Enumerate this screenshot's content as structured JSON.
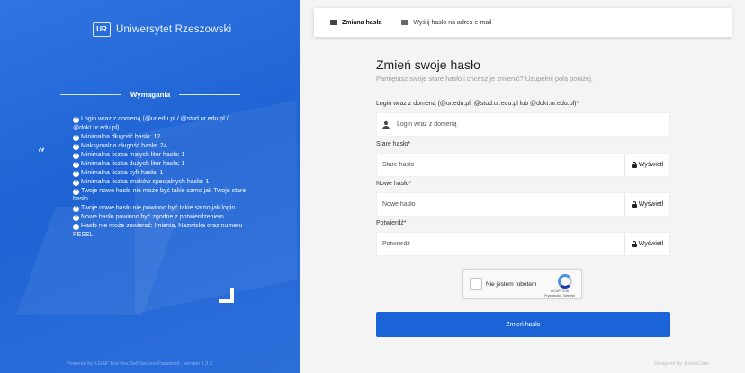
{
  "brand": {
    "logo_mark": "UR",
    "name": "Uniwersytet Rzeszowski"
  },
  "requirements": {
    "title": "Wymagania",
    "items": [
      "Login wraz z domeną (@ur.edu.pl / @stud.ur.edu.pl / @dokt.ur.edu.pl)",
      "Minimalna długość hasła: 12",
      "Maksymalna długość hasła: 24",
      "Minimalna liczba małych liter hasła: 1",
      "Minimalna liczba dużych liter hasła: 1",
      "Minimalna liczba cyfr hasła: 1",
      "Minimalna liczba znaków specjalnych hasła: 1",
      "Twoje nowe hasło nie może być takie samo jak Twoje stare hasło",
      "Twoje nowe hasło nie powinno być takie samo jak login",
      "Nowe hasło powinno być zgodne z potwierdzeniem",
      "Hasło nie może zawierać: Imienia, Nazwiska oraz numeru PESEL."
    ],
    "info_icon_glyph": "?",
    "last_icon_glyph": "i"
  },
  "quote_glyph": "“",
  "footer": {
    "left": "Powered by: LDAP Tool Box Self Service Password - version 1.3.3",
    "right": "Designed by: ExtenCode"
  },
  "tabs": [
    {
      "label": "Zmiana hasła",
      "icon": "envelope-icon",
      "active": true
    },
    {
      "label": "Wyślij hasło na adres e-mail",
      "icon": "envelope-icon",
      "active": false
    }
  ],
  "form": {
    "title": "Zmień swoje hasło",
    "subtitle": "Pamiętasz swoje stare hasło i chcesz je zmienić? Uzupełnij pola poniżej.",
    "login": {
      "label": "Login wraz z domeną (@ur.edu.pl, @stud.ur.edu.pl lub @dokt.ur.edu.pl)*",
      "placeholder": "Login wraz z domeną",
      "value": ""
    },
    "old_password": {
      "label": "Stare hasło*",
      "placeholder": "Stare hasło",
      "value": ""
    },
    "new_password": {
      "label": "Nowe hasło*",
      "placeholder": "Nowe hasło",
      "value": ""
    },
    "confirm_password": {
      "label": "Potwierdź*",
      "placeholder": "Potwierdź",
      "value": ""
    },
    "show_label": "Wyświetl",
    "submit_label": "Zmień hasło"
  },
  "captcha": {
    "label": "Nie jestem robotem",
    "brand": "reCAPTCHA",
    "links": "Prywatność - Warunki",
    "checked": false
  },
  "colors": {
    "left_panel": "#2166d6",
    "primary_button": "#1a64d8",
    "page_bg": "#f4f4f4"
  }
}
